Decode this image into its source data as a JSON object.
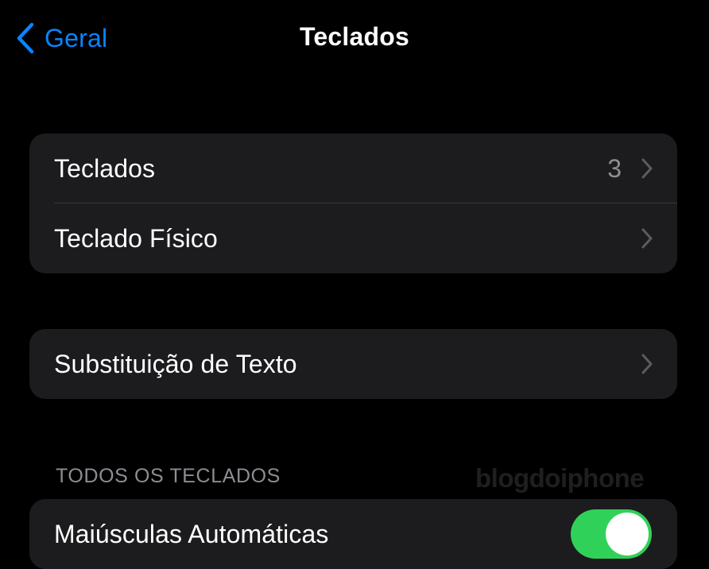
{
  "nav": {
    "back_label": "Geral",
    "title": "Teclados"
  },
  "groups": [
    {
      "rows": [
        {
          "label": "Teclados",
          "value": "3"
        },
        {
          "label": "Teclado Físico"
        }
      ]
    },
    {
      "rows": [
        {
          "label": "Substituição de Texto"
        }
      ]
    }
  ],
  "section_all": {
    "header": "TODOS OS TECLADOS",
    "rows": [
      {
        "label": "Maiúsculas Automáticas",
        "toggle_on": true
      }
    ]
  },
  "watermark": "blogdoiphone",
  "colors": {
    "background": "#000000",
    "cell": "#1c1c1e",
    "accent": "#0a84ff",
    "secondary_text": "#8d8d93",
    "toggle_on": "#30d158"
  }
}
